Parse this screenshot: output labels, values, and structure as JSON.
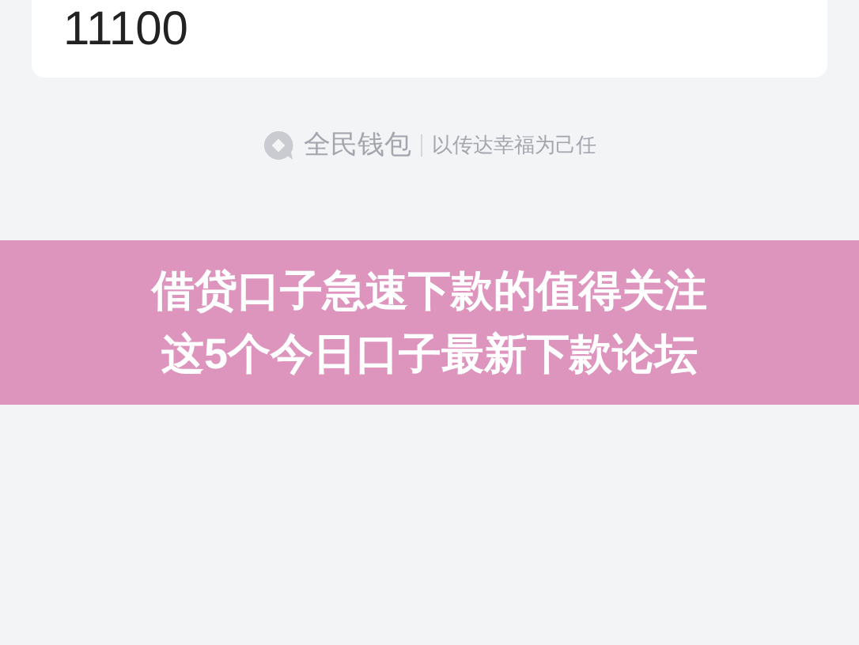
{
  "card": {
    "amount": "11100"
  },
  "footer": {
    "brand": "全民钱包",
    "slogan": "以传达幸福为己任"
  },
  "banner": {
    "lines": [
      "借贷口子急速下款的值得关注",
      "这5个今日口子最新下款论坛"
    ]
  }
}
